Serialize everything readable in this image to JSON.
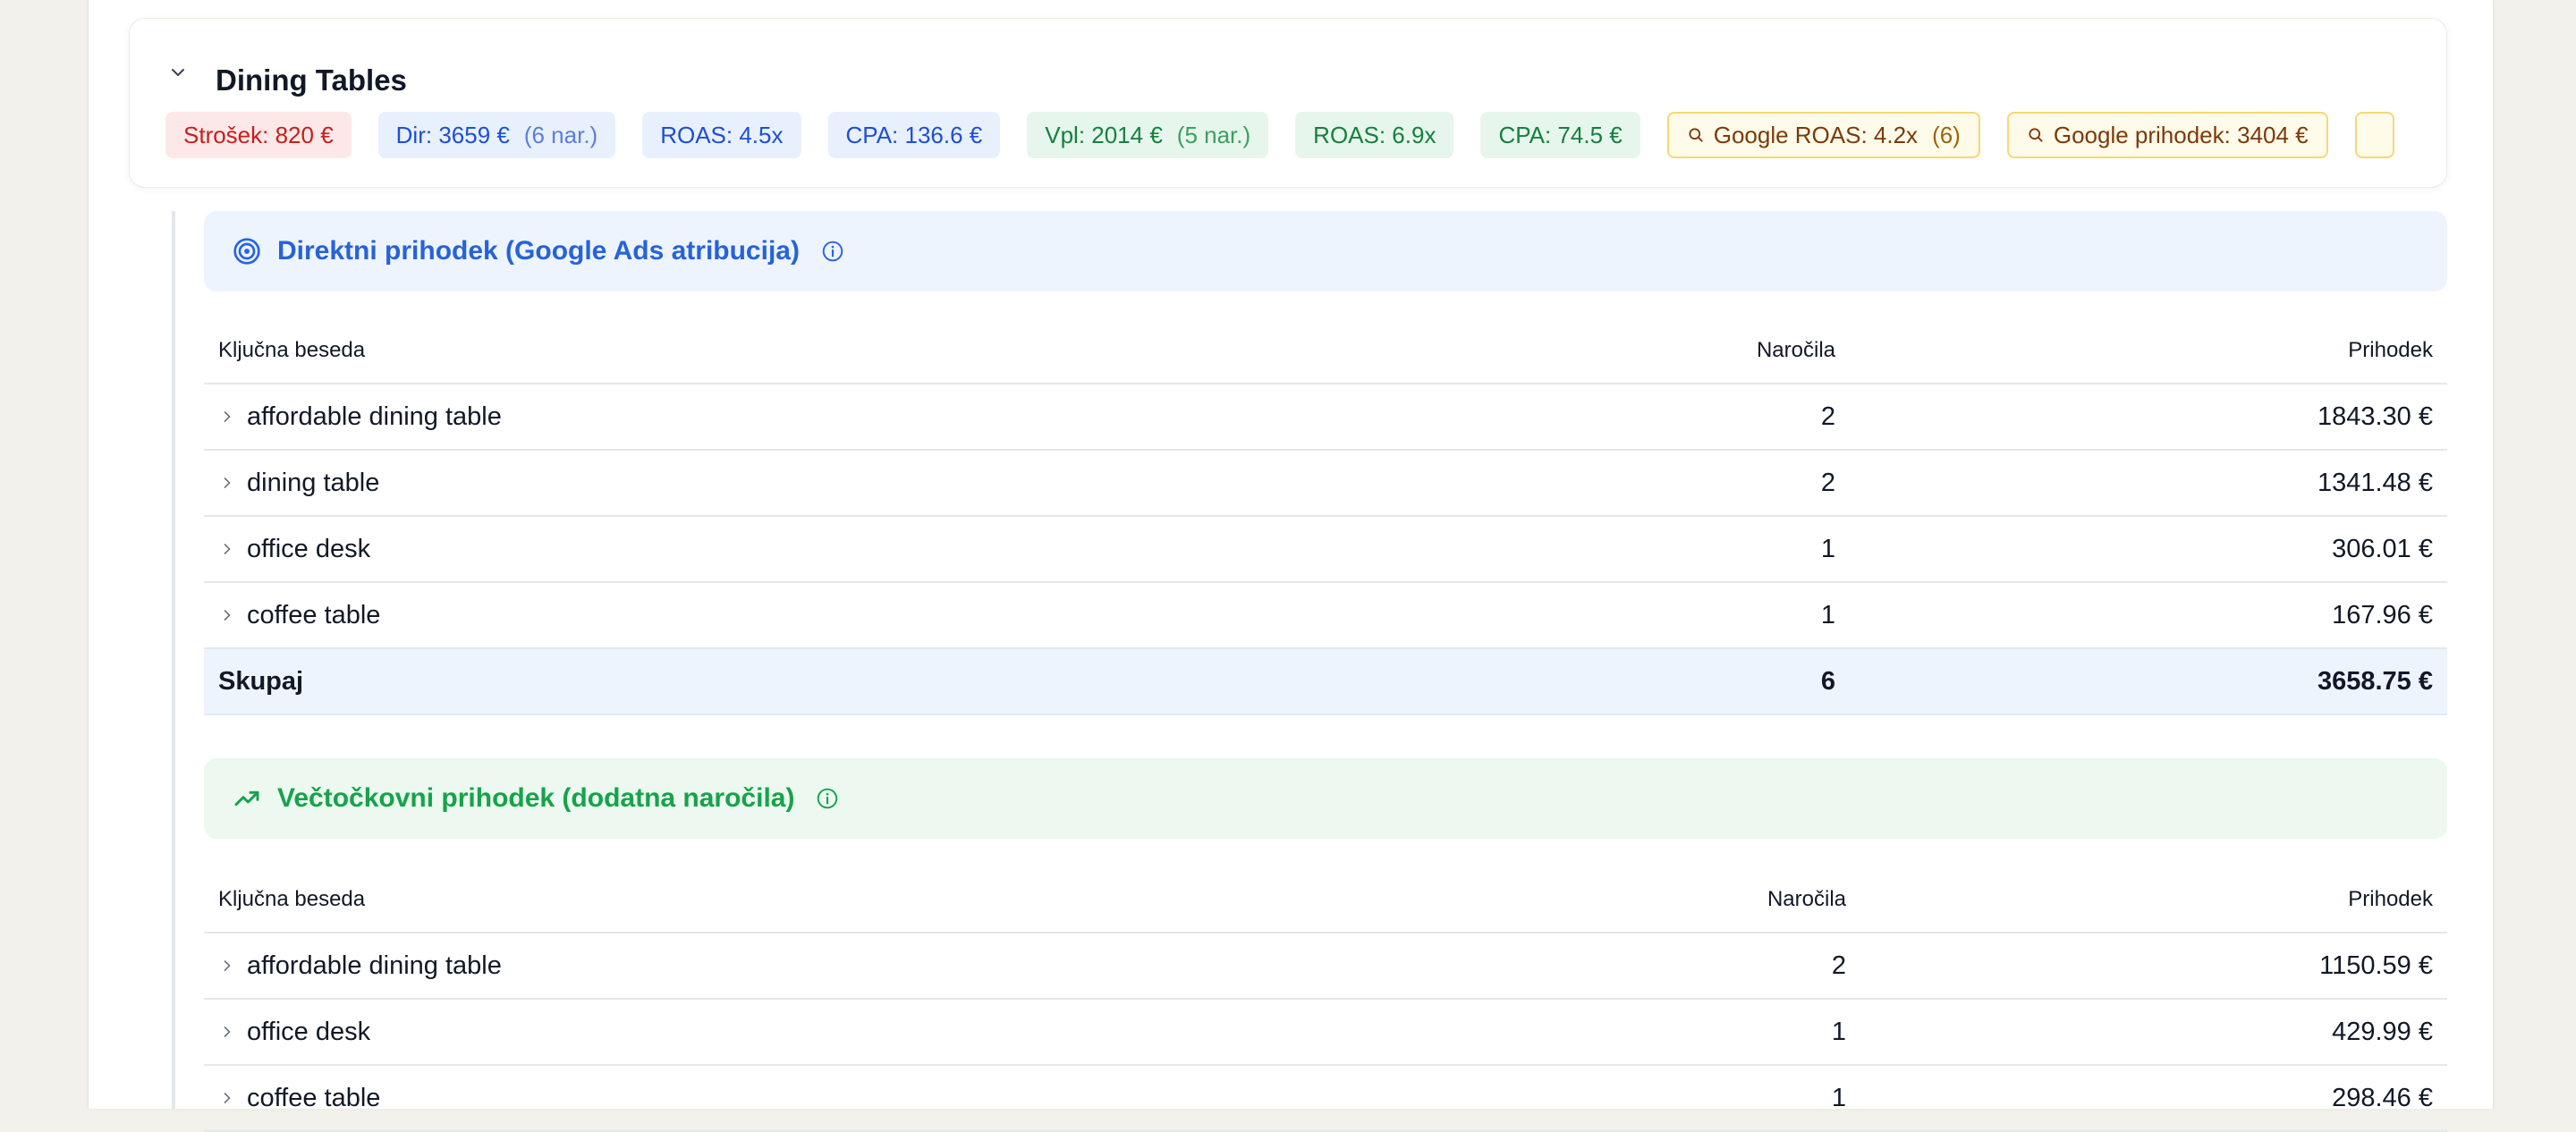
{
  "group": {
    "title": "Dining Tables",
    "badges": {
      "cost": "Strošek: 820 €",
      "direct": "Dir: 3659 €",
      "direct_orders": "(6 nar.)",
      "direct_roas": "ROAS: 4.5x",
      "direct_cpa": "CPA: 136.6 €",
      "assisted": "Vpl: 2014 €",
      "assisted_orders": "(5 nar.)",
      "assisted_roas": "ROAS: 6.9x",
      "assisted_cpa": "CPA: 74.5 €",
      "google_roas": "Google ROAS: 4.2x",
      "google_roas_count": "(6)",
      "google_revenue": "Google prihodek: 3404 €"
    }
  },
  "direct_section": {
    "title": "Direktni prihodek (Google Ads atribucija)",
    "columns": {
      "keyword": "Ključna beseda",
      "orders": "Naročila",
      "revenue": "Prihodek"
    },
    "rows": [
      {
        "keyword": "affordable dining table",
        "orders": "2",
        "revenue": "1843.30 €"
      },
      {
        "keyword": "dining table",
        "orders": "2",
        "revenue": "1341.48 €"
      },
      {
        "keyword": "office desk",
        "orders": "1",
        "revenue": "306.01 €"
      },
      {
        "keyword": "coffee table",
        "orders": "1",
        "revenue": "167.96 €"
      }
    ],
    "total": {
      "label": "Skupaj",
      "orders": "6",
      "revenue": "3658.75 €"
    }
  },
  "assisted_section": {
    "title": "Večtočkovni prihodek (dodatna naročila)",
    "columns": {
      "keyword": "Ključna beseda",
      "orders": "Naročila",
      "revenue": "Prihodek"
    },
    "rows": [
      {
        "keyword": "affordable dining table",
        "orders": "2",
        "revenue": "1150.59 €"
      },
      {
        "keyword": "office desk",
        "orders": "1",
        "revenue": "429.99 €"
      },
      {
        "keyword": "coffee table",
        "orders": "1",
        "revenue": "298.46 €"
      }
    ]
  },
  "colors": {
    "direct_accent": "#2563eb",
    "assisted_accent": "#16a34a",
    "cost_accent": "#c81e1e",
    "google_accent": "#7c3a0a"
  },
  "icons": {
    "collapse": "chevron-down-icon",
    "direct": "target-icon",
    "assisted": "trending-up-icon",
    "info": "info-icon",
    "row_expand": "chevron-right-icon",
    "google_badge": "search-icon"
  }
}
